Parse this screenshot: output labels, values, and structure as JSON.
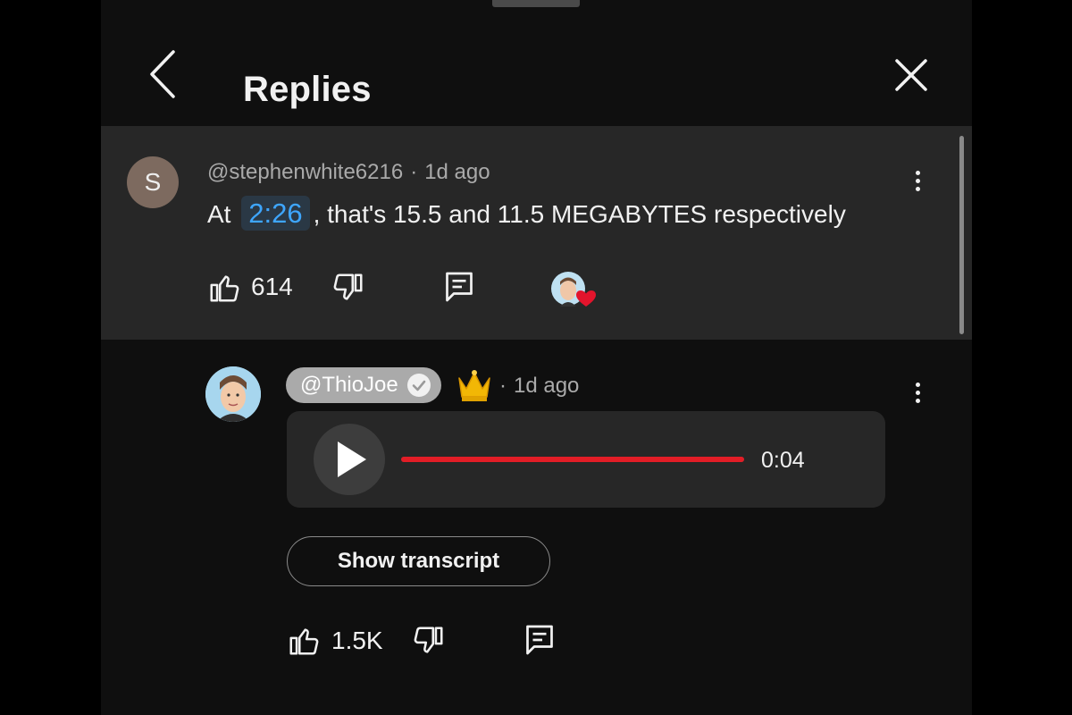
{
  "header": {
    "title": "Replies"
  },
  "parent_comment": {
    "avatar_letter": "S",
    "author": "@stephenwhite6216",
    "separator": "·",
    "age": "1d ago",
    "text_prefix": "At",
    "timestamp_link": "2:26",
    "text_suffix": ", that's 15.5 and 11.5 MEGABYTES respectively",
    "like_count": "614"
  },
  "reply": {
    "author": "@ThioJoe",
    "separator": "·",
    "age": "1d ago",
    "audio": {
      "duration": "0:04",
      "progress": 1.0
    },
    "transcript_label": "Show transcript",
    "like_count": "1.5K"
  },
  "colors": {
    "background": "#0f0f0f",
    "parent_bg": "#272727",
    "timestamp_link": "#3ea6ff",
    "progress": "#e21d26",
    "heart": "#e3142c",
    "author_chip": "#aaaaaa"
  },
  "icons": [
    "back-chevron-icon",
    "close-icon",
    "more-vert-icon",
    "thumb-up-icon",
    "thumb-down-icon",
    "reply-comment-icon",
    "creator-heart-icon",
    "verified-check-icon",
    "crown-icon",
    "play-icon"
  ]
}
